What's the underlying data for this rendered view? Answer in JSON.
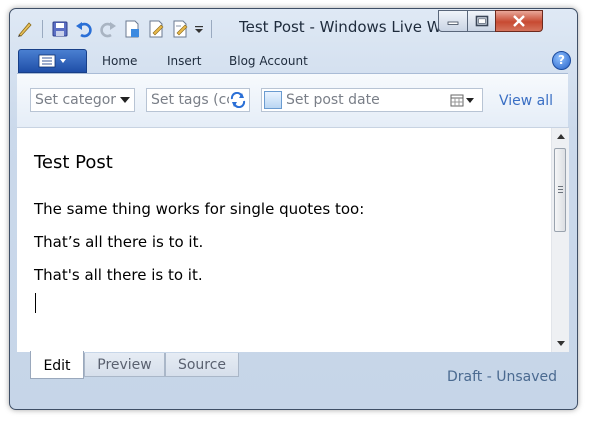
{
  "window": {
    "title": "Test Post - Windows Live W..."
  },
  "quick_access": {
    "icons": [
      "pen-icon",
      "save-icon",
      "undo-icon",
      "redo-icon",
      "new-post-icon",
      "open-post-icon",
      "edit-icon",
      "customize-dropdown-icon"
    ]
  },
  "ribbon": {
    "tabs": [
      "Home",
      "Insert",
      "Blog Account"
    ],
    "help_icon_text": "?"
  },
  "options": {
    "category_placeholder": "Set categor",
    "tags_placeholder": "Set tags (cc",
    "date_placeholder": "Set post date",
    "view_all": "View all"
  },
  "editor": {
    "post_title": "Test Post",
    "paragraphs": [
      "The same thing works for single quotes too:",
      "That’s all there is to it.",
      "That's all there is to it."
    ]
  },
  "bottom_tabs": [
    "Edit",
    "Preview",
    "Source"
  ],
  "status": "Draft - Unsaved",
  "colors": {
    "accent": "#1f4fa8",
    "link": "#3a6fc4",
    "close": "#c74a32"
  }
}
